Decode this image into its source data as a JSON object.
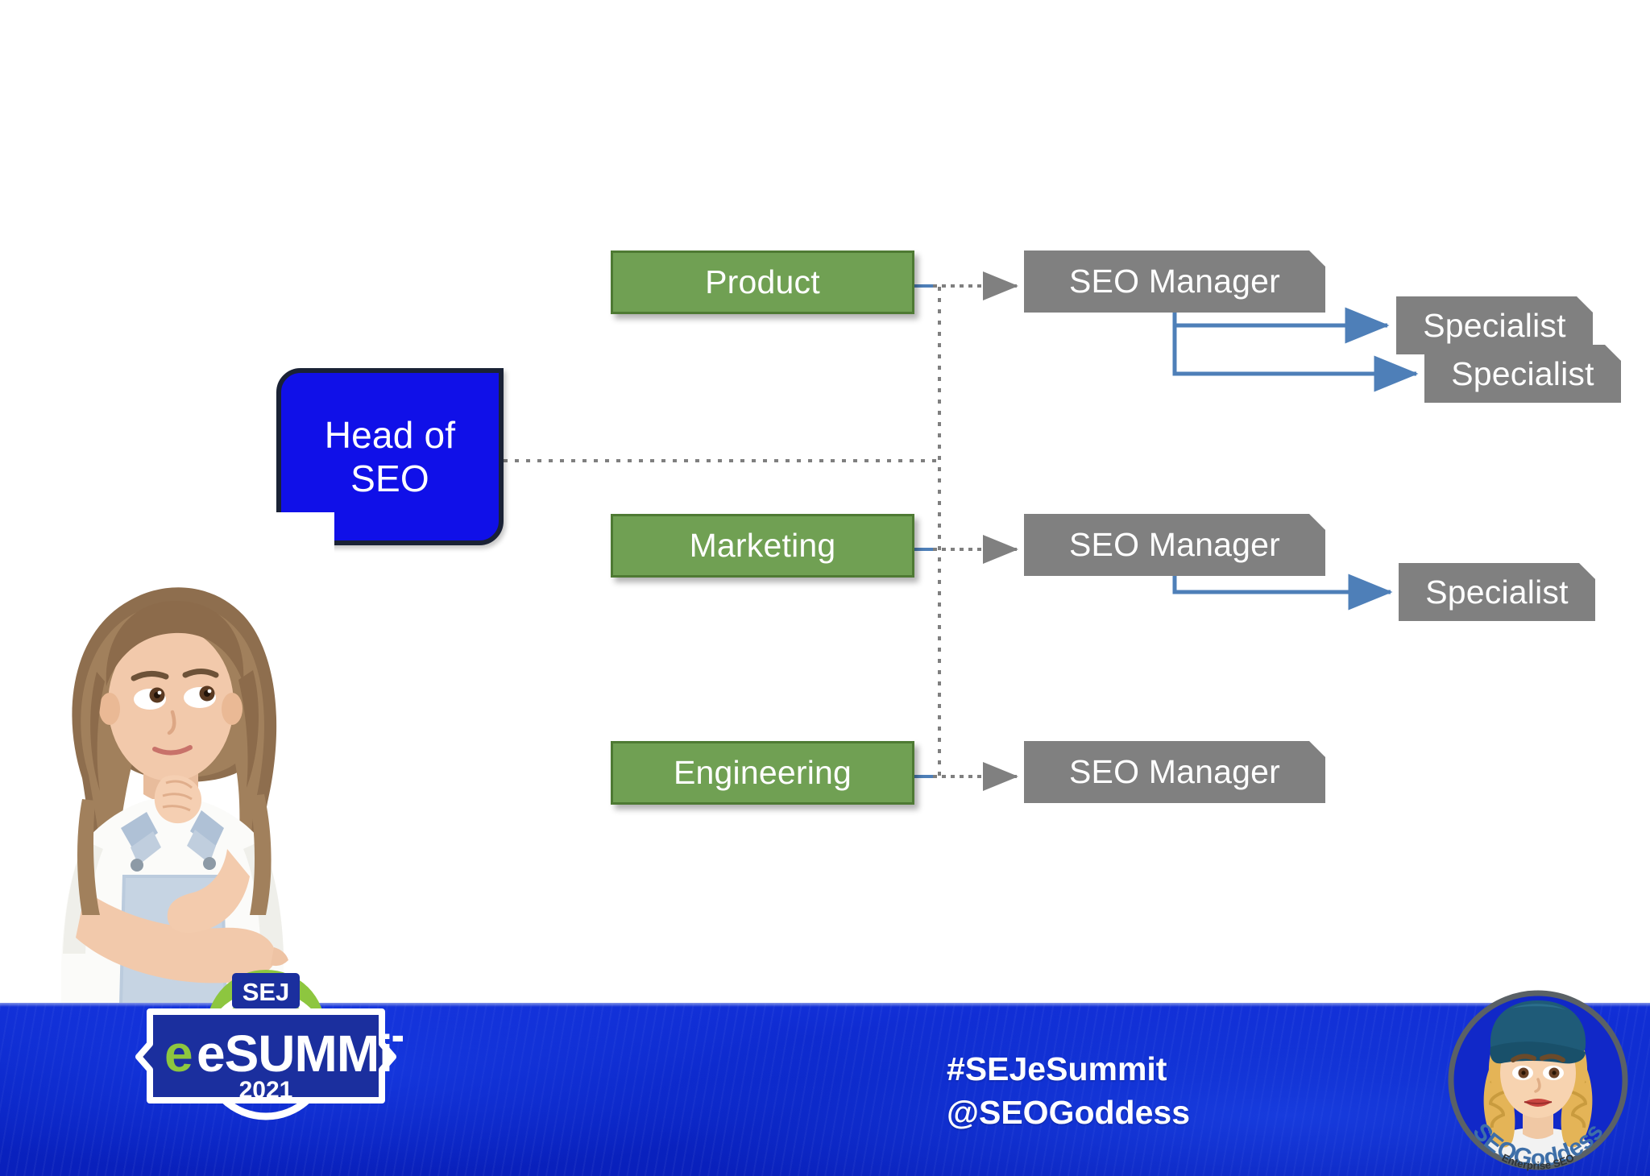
{
  "slide": {
    "background_color": "#ffffff",
    "type": "org-chart-slide"
  },
  "diagram": {
    "root": {
      "label_line1": "Head of",
      "label_line2": "SEO",
      "color": "#1010E8",
      "border_color": "#1A2235"
    },
    "departments": [
      {
        "label": "Product",
        "color": "#70A053",
        "border_color": "#4E7A33"
      },
      {
        "label": "Marketing",
        "color": "#70A053",
        "border_color": "#4E7A33"
      },
      {
        "label": "Engineering",
        "color": "#70A053",
        "border_color": "#4E7A33"
      }
    ],
    "managers": [
      {
        "label": "SEO Manager",
        "color": "#808080",
        "department": "Product"
      },
      {
        "label": "SEO Manager",
        "color": "#808080",
        "department": "Marketing"
      },
      {
        "label": "SEO Manager",
        "color": "#808080",
        "department": "Engineering"
      }
    ],
    "specialists": [
      {
        "label": "Specialist",
        "color": "#808080",
        "reports_to": "Product SEO Manager"
      },
      {
        "label": "Specialist",
        "color": "#808080",
        "reports_to": "Product SEO Manager"
      },
      {
        "label": "Specialist",
        "color": "#808080",
        "reports_to": "Marketing SEO Manager"
      }
    ],
    "connector_colors": {
      "solid": "#4E7FB8",
      "dotted": "#7F7F7F",
      "arrow_gray": "#808080",
      "arrow_blue": "#4E7FB8"
    }
  },
  "photo": {
    "alt": "Thoughtful young girl with long brown hair, white t-shirt and denim overalls, hand on chin"
  },
  "banner": {
    "background_color": "#0A25C6",
    "hashtag": "#SEJeSummit",
    "handle": "@SEOGoddess"
  },
  "sej_logo": {
    "top_text": "SEJ",
    "main_text": "eSUMMiT",
    "year": "2021",
    "accent_color": "#8DC63F",
    "fill_color": "#1B2F9E"
  },
  "goddess_logo": {
    "name": "SEOGoddess",
    "tagline": "Enterprise SEO",
    "cap_color": "#1F5B78",
    "hair_color": "#E4B457"
  }
}
